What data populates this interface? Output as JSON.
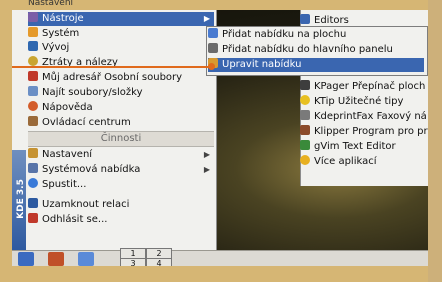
{
  "kmenu": {
    "top_cut": "Nastavení",
    "items": [
      {
        "label": "Nástroje",
        "icon": "tools-icon",
        "active": true,
        "submenu": true,
        "color": "#7b5ea7"
      },
      {
        "label": "Systém",
        "icon": "system-icon",
        "color": "#e59a2b"
      },
      {
        "label": "Vývoj",
        "icon": "development-icon",
        "color": "#2f68b0"
      },
      {
        "label": "Ztráty a nálezy",
        "icon": "lost-found-icon",
        "color": "#c9a530"
      },
      {
        "label": "Můj adresář Osobní soubory",
        "icon": "home-folder-icon",
        "color": "#c0392b"
      },
      {
        "label": "Najít soubory/složky",
        "icon": "find-files-icon",
        "color": "#6b8fc5"
      },
      {
        "label": "Nápověda",
        "icon": "help-icon",
        "color": "#d35c2a"
      },
      {
        "label": "Ovládací centrum",
        "icon": "control-center-icon",
        "color": "#9a6a3a"
      }
    ],
    "section_label": "Činnosti",
    "actions": [
      {
        "label": "Nastavení",
        "icon": "settings-icon",
        "submenu": true,
        "color": "#c69333"
      },
      {
        "label": "Systémová nabídka",
        "icon": "system-menu-icon",
        "submenu": true,
        "color": "#5874a8"
      },
      {
        "label": "Spustit...",
        "icon": "run-icon",
        "color": "#3a7ad8"
      },
      {
        "label": "Uzamknout relaci",
        "icon": "lock-session-icon",
        "color": "#2d5aa0"
      },
      {
        "label": "Odhlásit se...",
        "icon": "logout-icon",
        "color": "#c0392b"
      }
    ],
    "brand_strip": "KDE 3.5"
  },
  "submenu": {
    "items": [
      {
        "label": "Přidat nabídku na plochu",
        "icon": "add-menu-desktop-icon",
        "color": "#4a7bd0"
      },
      {
        "label": "Přidat nabídku do hlavního panelu",
        "icon": "add-menu-panel-icon",
        "color": "#6b6b6b"
      },
      {
        "label": "Upravit nabídku",
        "icon": "edit-menu-icon",
        "active": true,
        "color": "#d89a30"
      }
    ]
  },
  "editors_menu": {
    "items": [
      {
        "label": "Editors",
        "icon": "editors-icon",
        "color": "#3a66b0"
      },
      {
        "label": "KPager Přepínač ploch",
        "icon": "kpager-icon",
        "color": "#3d3d3d"
      },
      {
        "label": "KTip Užitečné tipy",
        "icon": "ktip-icon",
        "color": "#e8c020"
      },
      {
        "label": "KdeprintFax Faxový ná",
        "icon": "fax-icon",
        "color": "#7a7a7a"
      },
      {
        "label": "Klipper Program pro prá",
        "icon": "klipper-icon",
        "color": "#8b4a2a"
      },
      {
        "label": "gVim Text Editor",
        "icon": "gvim-icon",
        "color": "#3a8a3a"
      },
      {
        "label": "Více aplikací",
        "icon": "more-apps-icon",
        "color": "#e8b020"
      }
    ]
  },
  "taskbar": {
    "buttons": [
      {
        "name": "kmenu-button",
        "icon": "kde-logo-icon",
        "color": "#3a6ac0"
      },
      {
        "name": "home-button",
        "icon": "home-icon",
        "color": "#c05028"
      },
      {
        "name": "konqueror-button",
        "icon": "konqueror-icon",
        "color": "#5a8ad8"
      }
    ],
    "pager": [
      "1",
      "2",
      "3",
      "4"
    ]
  }
}
